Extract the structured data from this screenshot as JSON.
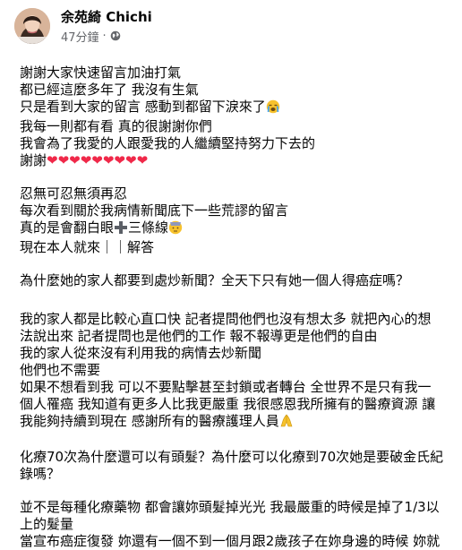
{
  "author": {
    "name": "余苑綺 Chichi",
    "time": "47分鐘",
    "separator": "·"
  },
  "post": {
    "lines_1": [
      "謝謝大家快速留言加油打氣",
      "都已經這麼多年了 我沒有生氣",
      "只是看到大家的留言 感動到都留下淚來了",
      "我每一則都有看 真的很謝謝你們",
      "我會為了我愛的人跟愛我的人繼續堅持努力下去的",
      "謝謝"
    ],
    "hearts": "❤❤❤❤❤❤❤❤❤",
    "lines_2": [
      "忍無可忍無須再忍",
      "每次看到關於我病情新聞底下一些荒謬的留言",
      "真的是會翻白眼",
      "三條線",
      "現在本人就來｜｜解答"
    ],
    "q1": "為什麼她的家人都要到處炒新聞？全天下只有她一個人得癌症嗎？",
    "a1": [
      "我的家人都是比較心直口快 記者提問他們也沒有想太多 就把內心的想",
      "法說出來 記者提問也是他們的工作 報不報導更是他們的自由",
      "我的家人從來沒有利用我的病情去炒新聞",
      "他們也不需要",
      "如果不想看到我 可以不要點擊甚至封鎖或者轉台 全世界不是只有我一",
      "個人罹癌 我知道有更多人比我更嚴重 我很感恩我所擁有的醫療資源 讓",
      "我能夠持續到現在 感謝所有的醫療護理人員"
    ],
    "q2": [
      "化療70次為什麼還可以有頭髮？為什麼可以化療到70次她是要破金氏紀",
      "錄嗎？"
    ],
    "a2": [
      "並不是每種化療藥物 都會讓妳頭髮掉光光 我最嚴重的時候是掉了1/3以",
      "上的髮量",
      "當宣布癌症復發 妳還有一個不到一個月跟2歲孩子在妳身邊的時候 妳就"
    ]
  },
  "icons": {
    "globe": "globe-icon",
    "crying": "loudly-crying-face-emoji",
    "plus": "heavy-plus-emoji",
    "sweat": "cold-sweat-face-emoji",
    "pray": "folded-hands-emoji"
  },
  "colors": {
    "text": "#050505",
    "meta": "#65676b",
    "heart": "#f02849"
  }
}
